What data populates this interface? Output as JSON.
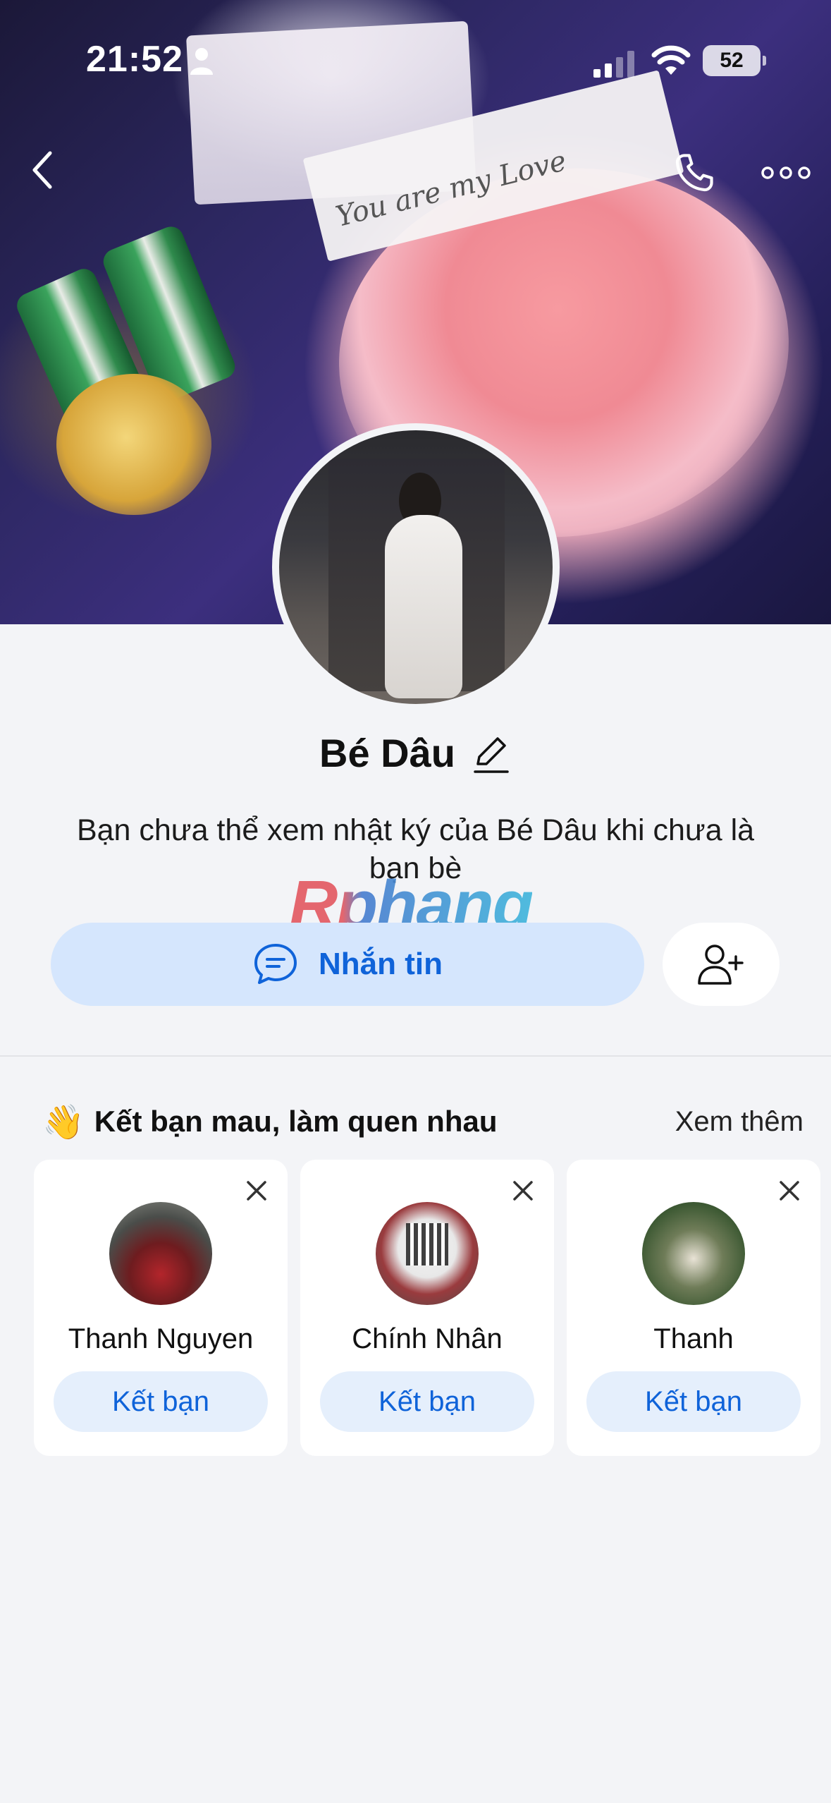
{
  "status_bar": {
    "time": "21:52",
    "battery": "52"
  },
  "cover": {
    "card_text": "You are my Love"
  },
  "header": {
    "back_icon": "chevron-left-icon",
    "call_icon": "phone-icon",
    "more_icon": "more-horizontal-icon"
  },
  "profile": {
    "name": "Bé Dâu",
    "notice": "Bạn chưa thể xem nhật ký của Bé Dâu khi chưa là bạn bè",
    "watermark": "Rphang"
  },
  "actions": {
    "message_label": "Nhắn tin",
    "message_icon": "chat-bubble-icon",
    "add_friend_icon": "user-plus-icon"
  },
  "suggestions": {
    "title": "Kết bạn mau, làm quen nhau",
    "wave_emoji": "👋",
    "see_more": "Xem thêm",
    "items": [
      {
        "name": "Thanh Nguyen",
        "button": "Kết bạn"
      },
      {
        "name": "Chính Nhân",
        "button": "Kết bạn"
      },
      {
        "name": "Thanh",
        "button": "Kết bạn"
      }
    ]
  },
  "colors": {
    "accent": "#0f63d9",
    "accent_soft": "#d5e6fd",
    "background": "#f3f4f7"
  }
}
